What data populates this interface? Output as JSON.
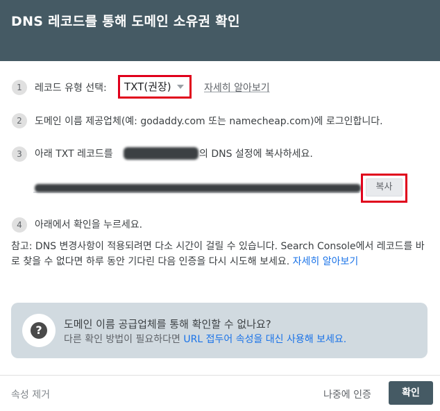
{
  "header": {
    "title": "DNS 레코드를 통해 도메인 소유권 확인"
  },
  "steps": [
    {
      "num": "1",
      "label": "레코드 유형 선택:"
    },
    {
      "num": "2",
      "text": "도메인 이름 제공업체(예: godaddy.com 또는 namecheap.com)에 로그인합니다."
    },
    {
      "num": "3",
      "text_before": "아래 TXT 레코드를",
      "text_after": "의 DNS 설정에 복사하세요."
    },
    {
      "num": "4",
      "text": "아래에서 확인을 누르세요."
    }
  ],
  "record_type": {
    "value": "TXT(권장)",
    "learn_more": "자세히 알아보기"
  },
  "copy_button": "복사",
  "note": {
    "text": "참고: DNS 변경사항이 적용되려면 다소 시간이 걸릴 수 있습니다. Search Console에서 레코드를 바로 찾을 수 없다면 하루 동안 기다린 다음 인증을 다시 시도해 보세요.",
    "link": "자세히 알아보기"
  },
  "info_card": {
    "title": "도메인 이름 공급업체를 통해 확인할 수 없나요?",
    "sub_prefix": "다른 확인 방법이 필요하다면",
    "sub_link": "URL 접두어 속성을 대신 사용해 보세요."
  },
  "footer": {
    "remove": "속성 제거",
    "later": "나중에 인증",
    "confirm": "확인"
  },
  "colors": {
    "header": "#455a64",
    "highlight": "#e0001b",
    "link": "#1a73e8",
    "card": "#d1dae0"
  },
  "icons": {
    "help": "question-circle-icon",
    "caret": "dropdown-caret-icon"
  }
}
